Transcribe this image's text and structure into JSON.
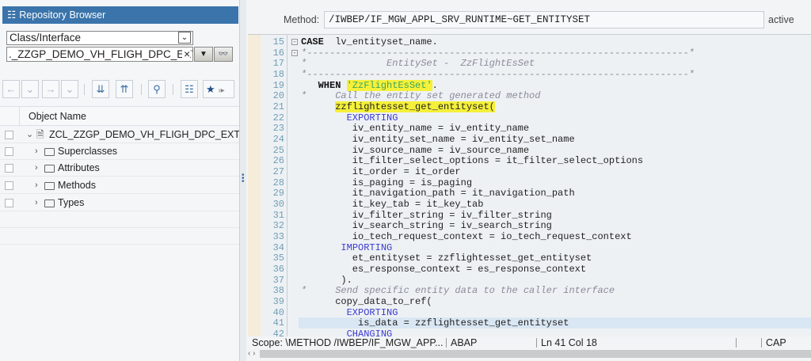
{
  "repository_browser": {
    "title": "Repository Browser",
    "object_type": "Class/Interface",
    "object_name": "._ZZGP_DEMO_VH_FLIGH_DPC_EXT",
    "tree_header": "Object Name",
    "tree": [
      {
        "label": "ZCL_ZZGP_DEMO_VH_FLIGH_DPC_EXT",
        "level": 0,
        "expanded": true
      },
      {
        "label": "Superclasses",
        "level": 1,
        "expanded": false
      },
      {
        "label": "Attributes",
        "level": 1,
        "expanded": false
      },
      {
        "label": "Methods",
        "level": 1,
        "expanded": false
      },
      {
        "label": "Types",
        "level": 1,
        "expanded": false
      }
    ]
  },
  "editor": {
    "method_label": "Method:",
    "method_name": "/IWBEP/IF_MGW_APPL_SRV_RUNTIME~GET_ENTITYSET",
    "status": "active",
    "current_line": 41,
    "lines": [
      {
        "n": 15,
        "fold": "-",
        "seg": [
          [
            "k",
            "CASE"
          ],
          [
            "",
            "  lv_entityset_name."
          ]
        ]
      },
      {
        "n": 16,
        "fold": "-",
        "seg": [
          [
            "c",
            "*-------------------------------------------------------------------*"
          ]
        ]
      },
      {
        "n": 17,
        "seg": [
          [
            "c",
            "*              EntitySet -  ZzFlightEsSet"
          ]
        ]
      },
      {
        "n": 18,
        "seg": [
          [
            "c",
            "*-------------------------------------------------------------------*"
          ]
        ]
      },
      {
        "n": 19,
        "seg": [
          [
            "",
            "   "
          ],
          [
            "k",
            "WHEN"
          ],
          [
            "",
            ""
          ],
          [
            "",
            " "
          ],
          [
            "s hl",
            "'ZzFlightEsSet'"
          ],
          [
            "",
            "."
          ]
        ]
      },
      {
        "n": 20,
        "seg": [
          [
            "c",
            "*     Call the entity set generated method"
          ]
        ]
      },
      {
        "n": 21,
        "seg": [
          [
            "",
            "      "
          ],
          [
            "hl",
            "zzflightesset_get_entityset("
          ]
        ]
      },
      {
        "n": 22,
        "seg": [
          [
            "",
            "        "
          ],
          [
            "kw",
            "EXPORTING"
          ]
        ]
      },
      {
        "n": 23,
        "seg": [
          [
            "",
            "         iv_entity_name = iv_entity_name"
          ]
        ]
      },
      {
        "n": 24,
        "seg": [
          [
            "",
            "         iv_entity_set_name = iv_entity_set_name"
          ]
        ]
      },
      {
        "n": 25,
        "seg": [
          [
            "",
            "         iv_source_name = iv_source_name"
          ]
        ]
      },
      {
        "n": 26,
        "seg": [
          [
            "",
            "         it_filter_select_options = it_filter_select_options"
          ]
        ]
      },
      {
        "n": 27,
        "seg": [
          [
            "",
            "         it_order = it_order"
          ]
        ]
      },
      {
        "n": 28,
        "seg": [
          [
            "",
            "         is_paging = is_paging"
          ]
        ]
      },
      {
        "n": 29,
        "seg": [
          [
            "",
            "         it_navigation_path = it_navigation_path"
          ]
        ]
      },
      {
        "n": 30,
        "seg": [
          [
            "",
            "         it_key_tab = it_key_tab"
          ]
        ]
      },
      {
        "n": 31,
        "seg": [
          [
            "",
            "         iv_filter_string = iv_filter_string"
          ]
        ]
      },
      {
        "n": 32,
        "seg": [
          [
            "",
            "         iv_search_string = iv_search_string"
          ]
        ]
      },
      {
        "n": 33,
        "seg": [
          [
            "",
            "         io_tech_request_context = io_tech_request_context"
          ]
        ]
      },
      {
        "n": 34,
        "seg": [
          [
            "",
            "       "
          ],
          [
            "kw",
            "IMPORTING"
          ]
        ]
      },
      {
        "n": 35,
        "seg": [
          [
            "",
            "         et_entityset = zzflightesset_get_entityset"
          ]
        ]
      },
      {
        "n": 36,
        "seg": [
          [
            "",
            "         es_response_context = es_response_context"
          ]
        ]
      },
      {
        "n": 37,
        "seg": [
          [
            "",
            "       )."
          ]
        ]
      },
      {
        "n": 38,
        "seg": [
          [
            "c",
            "*     Send specific entity data to the caller interface"
          ]
        ]
      },
      {
        "n": 39,
        "seg": [
          [
            "",
            "      copy_data_to_ref("
          ]
        ]
      },
      {
        "n": 40,
        "seg": [
          [
            "",
            "        "
          ],
          [
            "kw",
            "EXPORTING"
          ]
        ]
      },
      {
        "n": 41,
        "seg": [
          [
            "",
            "          is_data = zzflightesset_get_entityset"
          ]
        ]
      },
      {
        "n": 42,
        "seg": [
          [
            "",
            "        "
          ],
          [
            "kw",
            "CHANGING"
          ]
        ]
      }
    ]
  },
  "statusbar": {
    "scope": "Scope: \\METHOD /IWBEP/IF_MGW_APP...",
    "language": "ABAP",
    "position": "Ln  41 Col  18",
    "caps": "CAP"
  }
}
